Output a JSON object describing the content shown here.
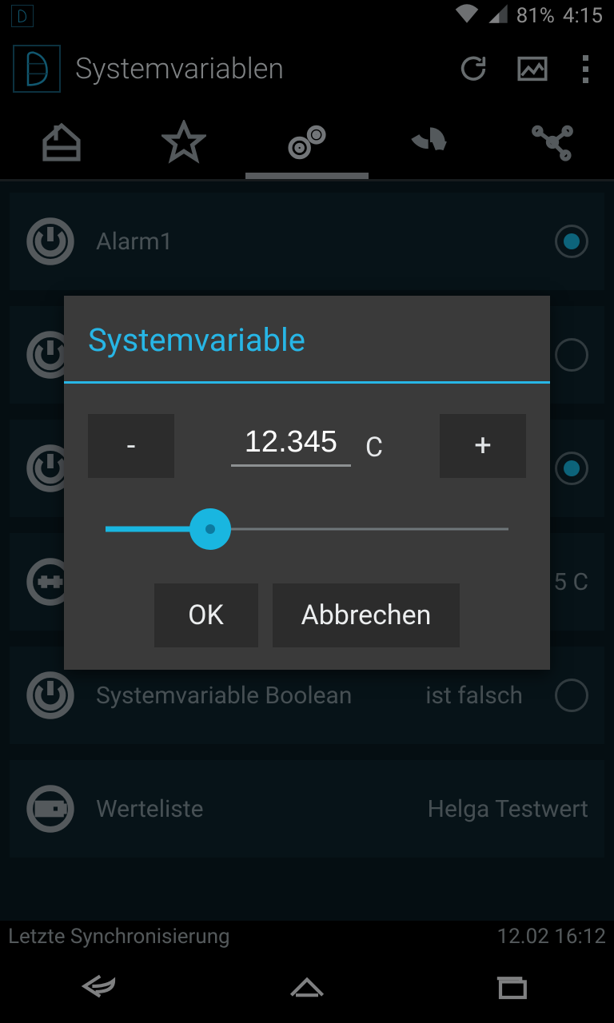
{
  "status": {
    "battery_pct": "81%",
    "clock": "4:15"
  },
  "actionbar": {
    "title": "Systemvariablen"
  },
  "tabs": {
    "active_index": 2
  },
  "rows": [
    {
      "icon": "power",
      "label": "Alarm1",
      "value": "",
      "radio": "on"
    },
    {
      "icon": "power",
      "label": "",
      "value": "",
      "radio": "off"
    },
    {
      "icon": "power",
      "label": "",
      "value": "",
      "radio": "on"
    },
    {
      "icon": "tuning",
      "label": "",
      "value": "5 C",
      "radio": ""
    },
    {
      "icon": "power",
      "label": "Systemvariable Boolean",
      "value": "ist falsch",
      "radio": "off"
    },
    {
      "icon": "battery",
      "label": "Werteliste",
      "value": "Helga Testwert",
      "radio": ""
    }
  ],
  "sync": {
    "label": "Letzte Synchronisierung",
    "time": "12.02 16:12"
  },
  "dialog": {
    "title": "Systemvariable",
    "minus": "-",
    "plus": "+",
    "value": "12.345",
    "unit": "C",
    "slider_pct": 26,
    "ok": "OK",
    "cancel": "Abbrechen"
  }
}
